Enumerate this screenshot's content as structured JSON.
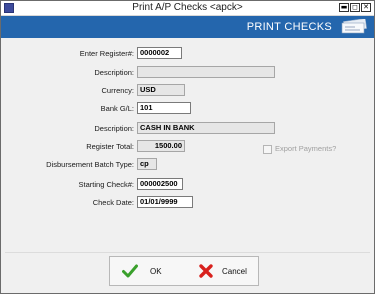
{
  "window": {
    "title": "Print A/P Checks <apck>",
    "minimize_glyph": "▬",
    "maximize_glyph": "◻",
    "close_glyph": "✕"
  },
  "header": {
    "title": "PRINT CHECKS",
    "logo_icon": "checks-icon"
  },
  "form": {
    "register_label": "Enter Register#:",
    "register_value": "0000002",
    "description_label": "Description:",
    "description_value": "",
    "currency_label": "Currency:",
    "currency_value": "USD",
    "bank_gl_label": "Bank G/L:",
    "bank_gl_value": "101",
    "bank_description_label": "Description:",
    "bank_description_value": "CASH IN BANK",
    "register_total_label": "Register Total:",
    "register_total_value": "1500.00",
    "batch_type_label": "Disbursement Batch Type:",
    "batch_type_value": "cp",
    "starting_check_label": "Starting Check#:",
    "starting_check_value": "000002500",
    "check_date_label": "Check Date:",
    "check_date_value": "01/01/9999",
    "export_payments_label": "Export Payments?",
    "export_payments_checked": false
  },
  "buttons": {
    "ok_label": "OK",
    "cancel_label": "Cancel"
  },
  "colors": {
    "header": "#2466ad",
    "ok": "#3aa02c",
    "cancel": "#d8211d"
  }
}
